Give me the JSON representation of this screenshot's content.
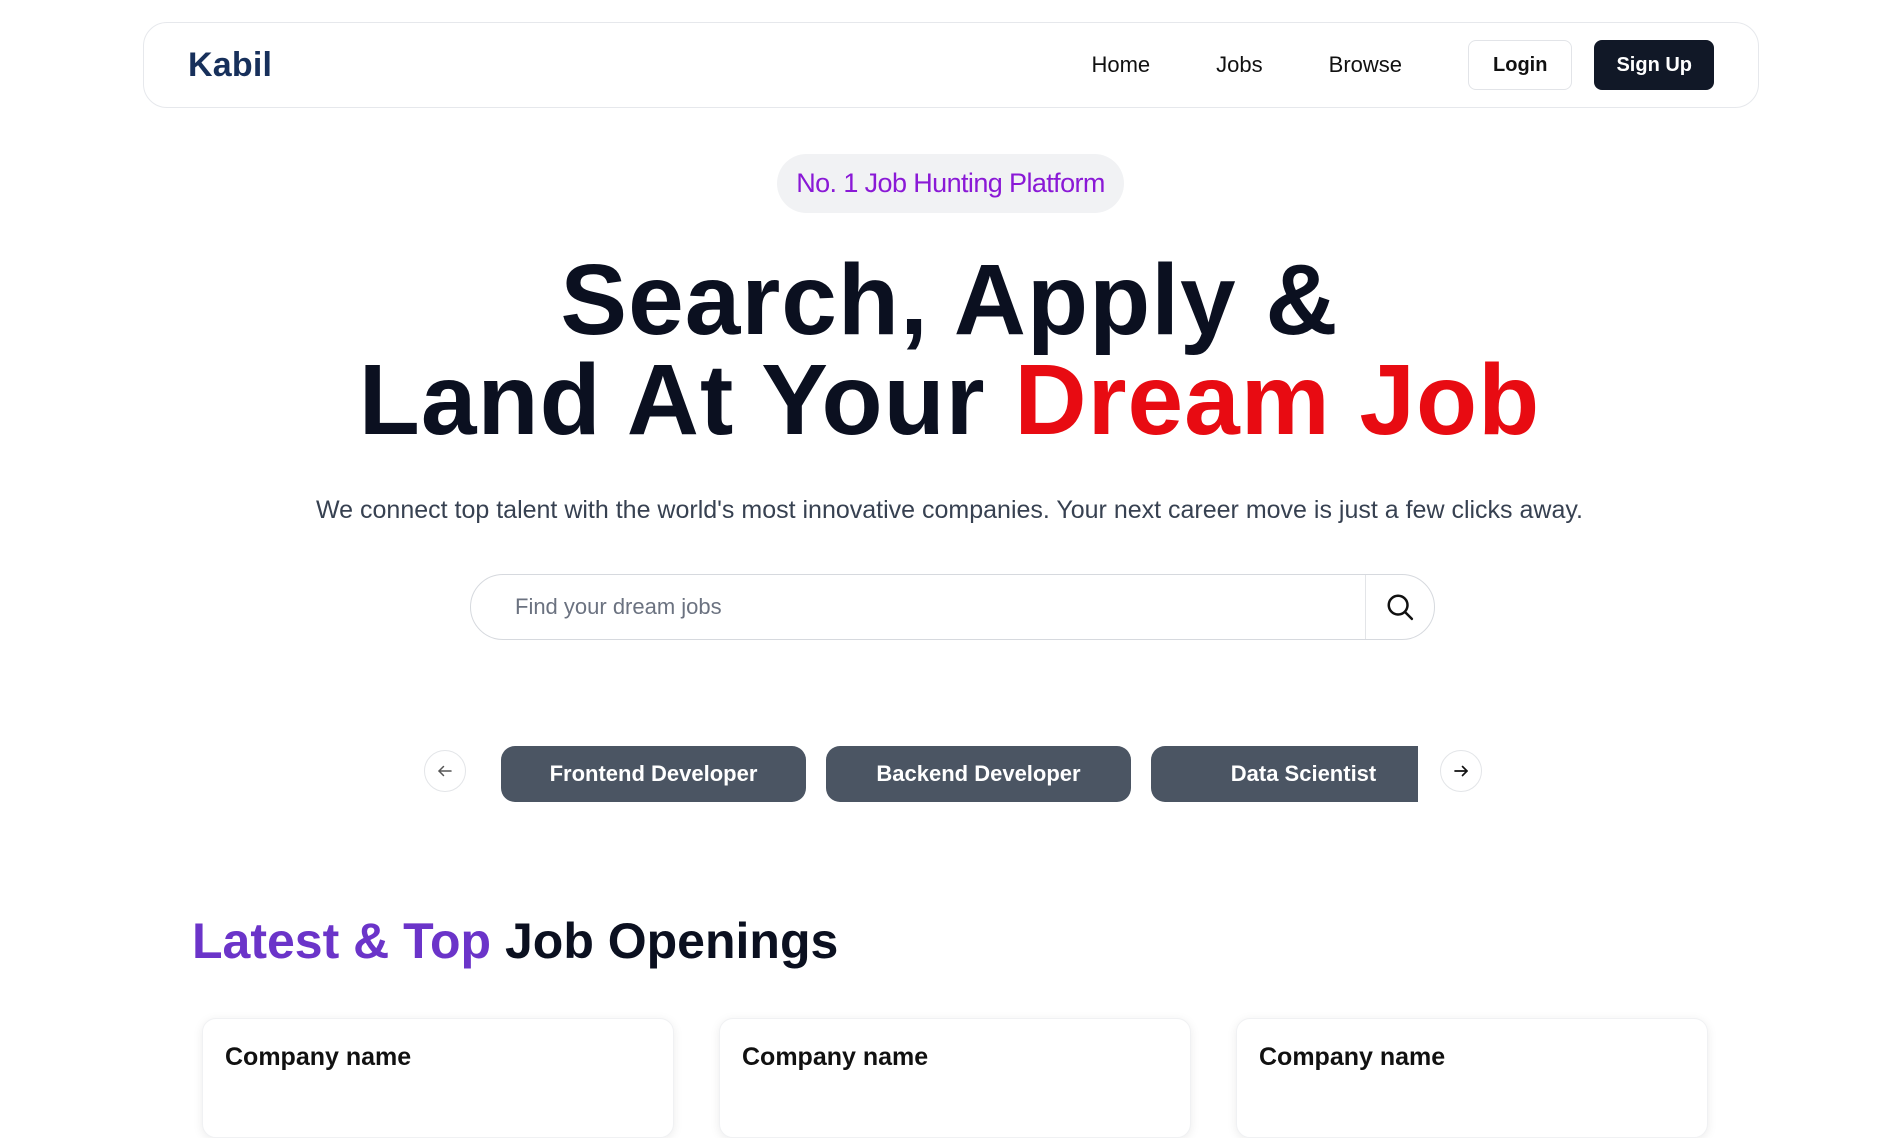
{
  "navbar": {
    "logo": "Kabil",
    "links": [
      "Home",
      "Jobs",
      "Browse"
    ],
    "login_label": "Login",
    "signup_label": "Sign Up"
  },
  "hero": {
    "badge": "No. 1 Job Hunting Platform",
    "title_line1": "Search, Apply &",
    "title_line2_plain": "Land At Your ",
    "title_line2_accent": "Dream Job",
    "subtitle": "We connect top talent with the world's most innovative companies. Your next career move is just a few clicks away.",
    "accent_color": "#e80b12"
  },
  "search": {
    "placeholder": "Find your dream jobs",
    "icon": "search-icon"
  },
  "carousel": {
    "prev_icon": "arrow-left-icon",
    "next_icon": "arrow-right-icon",
    "categories": [
      "Frontend Developer",
      "Backend Developer",
      "Data Scientist"
    ]
  },
  "section": {
    "title_accent": "Latest & Top",
    "title_plain": " Job Openings",
    "accent_color": "#6b34c9"
  },
  "jobs": [
    {
      "company": "Company name"
    },
    {
      "company": "Company name"
    },
    {
      "company": "Company name"
    }
  ]
}
